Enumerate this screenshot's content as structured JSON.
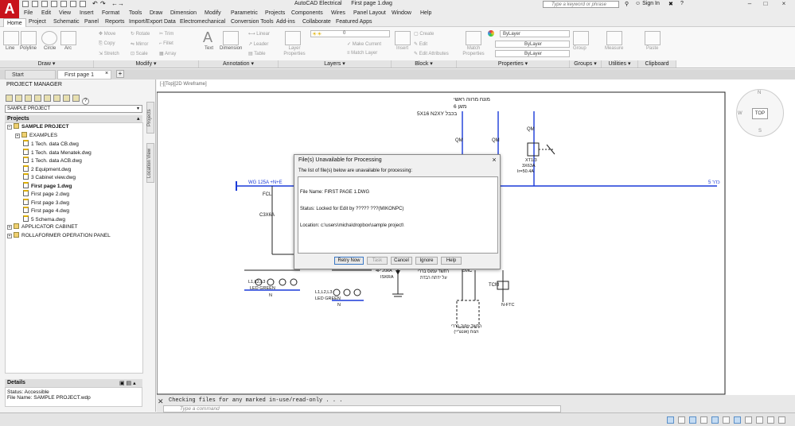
{
  "title_bar": {
    "app_name": "AutoCAD Electrical",
    "document": "First page 1.dwg",
    "search_placeholder": "Type a keyword or phrase",
    "sign_in": "Sign In"
  },
  "menu": [
    "File",
    "Edit",
    "View",
    "Insert",
    "Format",
    "Tools",
    "Draw",
    "Dimension",
    "Modify",
    "Parametric",
    "Projects",
    "Components",
    "Wires",
    "Panel Layout",
    "Window",
    "Help"
  ],
  "ribbon_tabs": [
    "Home",
    "Project",
    "Schematic",
    "Panel",
    "Reports",
    "Import/Export Data",
    "Electromechanical",
    "Conversion Tools",
    "Add-ins",
    "Collaborate",
    "Featured Apps"
  ],
  "ribbon_tabs_active": "Home",
  "ribbon": {
    "draw_tools": [
      "Line",
      "Polyline",
      "Circle",
      "Arc"
    ],
    "modify": {
      "move": "Move",
      "rotate": "Rotate",
      "trim": "Trim",
      "copy": "Copy",
      "mirror": "Mirror",
      "fillet": "Fillet",
      "stretch": "Stretch",
      "scale": "Scale",
      "array": "Array"
    },
    "annotation": {
      "text": "Text",
      "dimension": "Dimension",
      "linear": "Linear",
      "leader": "Leader",
      "table": "Table"
    },
    "layers": {
      "layer_properties": "Layer Properties",
      "layer_value": "0",
      "make_current": "Make Current",
      "match_layer": "Match Layer"
    },
    "block": {
      "insert": "Insert",
      "create": "Create",
      "edit": "Edit",
      "edit_attributes": "Edit Attributes"
    },
    "properties": {
      "match_properties": "Match Properties",
      "bylayer": "ByLayer"
    },
    "groups": {
      "group": "Group"
    },
    "utilities": {
      "measure": "Measure"
    },
    "clipboard": {
      "paste": "Paste"
    },
    "panel_titles": [
      "Draw",
      "Modify",
      "Annotation",
      "Layers",
      "Block",
      "Properties",
      "Groups",
      "Utilities",
      "Clipboard"
    ]
  },
  "doc_tabs": [
    "Start",
    "First page 1"
  ],
  "doc_tab_active": "First page 1",
  "project_manager": {
    "title": "PROJECT MANAGER",
    "project_combo": "SAMPLE PROJECT",
    "projects_header": "Projects",
    "tree": [
      {
        "label": "SAMPLE PROJECT",
        "kind": "project",
        "level": 0,
        "bold": true
      },
      {
        "label": "EXAMPLES",
        "kind": "folder",
        "level": 1,
        "bold": false
      },
      {
        "label": "1 Tech. data CB.dwg",
        "kind": "file",
        "level": 2,
        "bold": false
      },
      {
        "label": "1 Tech. data Menatek.dwg",
        "kind": "file",
        "level": 2,
        "bold": false
      },
      {
        "label": "1 Tech. data ACB.dwg",
        "kind": "file",
        "level": 2,
        "bold": false
      },
      {
        "label": "2 Equipment.dwg",
        "kind": "file",
        "level": 2,
        "bold": false
      },
      {
        "label": "3 Cabinet view.dwg",
        "kind": "file",
        "level": 2,
        "bold": false
      },
      {
        "label": "First page 1.dwg",
        "kind": "file",
        "level": 2,
        "bold": true
      },
      {
        "label": "First page 2.dwg",
        "kind": "file",
        "level": 2,
        "bold": false
      },
      {
        "label": "First page 3.dwg",
        "kind": "file",
        "level": 2,
        "bold": false
      },
      {
        "label": "First page 4.dwg",
        "kind": "file",
        "level": 2,
        "bold": false
      },
      {
        "label": "5 Schema.dwg",
        "kind": "file",
        "level": 2,
        "bold": false
      },
      {
        "label": "APPLICATOR CABINET",
        "kind": "project",
        "level": 0,
        "bold": false
      },
      {
        "label": "ROLLAFORMER OPERATION PANEL",
        "kind": "project",
        "level": 0,
        "bold": false
      }
    ],
    "side_tabs": [
      "Projects",
      "Location View"
    ],
    "details_header": "Details",
    "details": {
      "status": "Status: Accessible",
      "file_name": "File Name: SAMPLE PROJECT.wdp"
    }
  },
  "viewport_label": "[-][Top][2D Wireframe]",
  "viewcube": {
    "top": "TOP",
    "n": "N",
    "s": "S",
    "w": "W"
  },
  "drawing_text": {
    "hebrew_title1": "מונח מרווה ראשי",
    "hebrew_title2": "מזגן 6",
    "cable": "5X16 N2XY בכבל",
    "wg": "WG 125A +N+E",
    "qm1": "QM",
    "qm2": "QM",
    "qm3": "QM",
    "xt": "XT1/3",
    "rating": "3X63A",
    "ir": "Ir=50.4A",
    "fcl": "FCL",
    "c3x6": "C3X6A",
    "led1": "L1,L2,L3",
    "led_green1": "LED GREEN",
    "led2": "L1,L2,L3",
    "led_green2": "LED GREEN",
    "n1": "N",
    "n2": "N",
    "surge": "4P 20kA",
    "isk": "ISKRA",
    "emc": "EMC",
    "tcm": "TCM",
    "nftc": "N-FTC",
    "hebrew_note1": "רתשד עמוס בררי",
    "hebrew_note2": "על ידתח רבדת",
    "hebrew_bottom": "רתשד זיפוק בררי ויצוח (אונגריי)",
    "bus_right": "5 כדר"
  },
  "dialog": {
    "title": "File(s) Unavailable for Processing",
    "message": "The list of file(s) below are unavailable for processing:",
    "lines": [
      "File Name: FIRST PAGE 1.DWG",
      "Status: Locked for Edit by ????? ???(MIKONPC)",
      "Location: c:\\users\\micha\\dropbox\\sample project\\"
    ],
    "buttons": {
      "retry": "Retry Now",
      "task": "Task",
      "cancel": "Cancel",
      "ignore": "Ignore",
      "help": "Help"
    }
  },
  "command_line": {
    "history": "Checking files for any marked in-use/read-only . . .",
    "placeholder": "Type a command"
  }
}
